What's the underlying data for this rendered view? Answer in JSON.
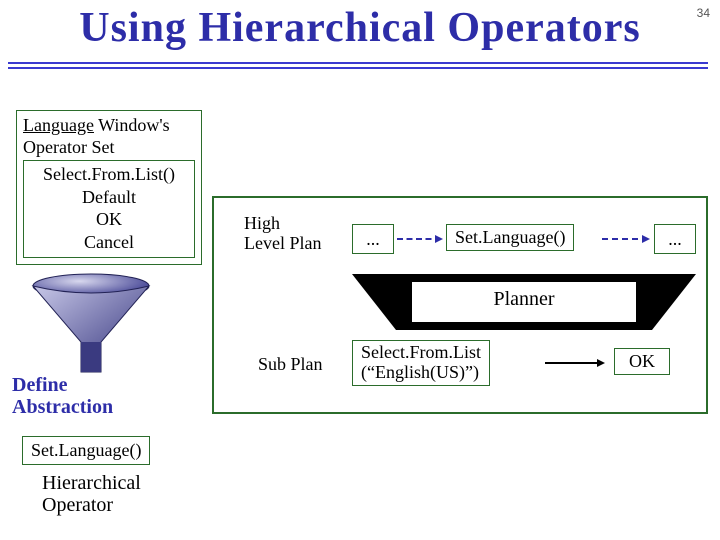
{
  "title": "Using Hierarchical Operators",
  "page_number": "34",
  "language_window": {
    "header_line1_underlined": "Language",
    "header_line1_rest": " Window's",
    "header_line2": "Operator Set",
    "operators": [
      "Select.From.List()",
      "Default",
      "OK",
      "Cancel"
    ]
  },
  "define_abstraction_label_line1": "Define",
  "define_abstraction_label_line2": "Abstraction",
  "set_language_pill": "Set.Language()",
  "hierarchical_operator_line1": "Hierarchical",
  "hierarchical_operator_line2": "Operator",
  "main": {
    "high_level_plan_line1": "High",
    "high_level_plan_line2": "Level Plan",
    "dots": "...",
    "set_language_node": "Set.Language()",
    "planner_label": "Planner",
    "sub_plan_label": "Sub Plan",
    "subplan_node_line1": "Select.From.List",
    "subplan_node_line2": "(“English(US)”)",
    "ok_node": "OK"
  },
  "colors": {
    "title": "#2d2da8",
    "box_border": "#2b6c2b",
    "arrow_dashed": "#2d2da8"
  }
}
